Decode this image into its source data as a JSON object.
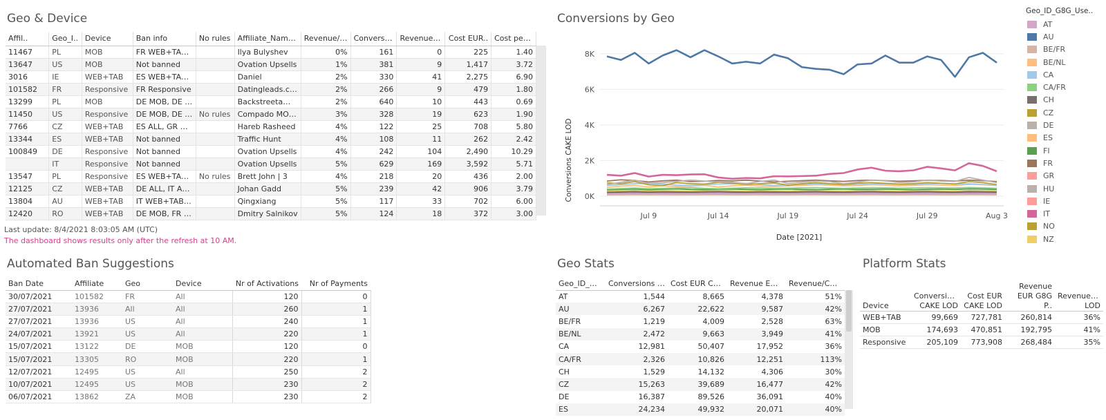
{
  "geo_device": {
    "title": "Geo & Device",
    "columns": [
      "Affil..",
      "Geo_I..",
      "Device",
      "Ban info",
      "No rules",
      "Affiliate_Name_..",
      "Revenue/C..",
      "Conversio..",
      "Revenue E..",
      "Cost EUR..",
      "Cost per C.."
    ],
    "rows": [
      [
        "11467",
        "PL",
        "MOB",
        "FR WEB+TAB, C..",
        "",
        "Ilya Bulyshev",
        "0%",
        "161",
        "0",
        "225",
        "1.40"
      ],
      [
        "13647",
        "US",
        "MOB",
        "Not banned",
        "",
        "Ovation Upsells",
        "1%",
        "381",
        "9",
        "1,417",
        "3.72"
      ],
      [
        "3016",
        "IE",
        "WEB+TAB",
        "ES WEB+TAB, ..",
        "",
        "Daniel",
        "2%",
        "330",
        "41",
        "2,275",
        "6.90"
      ],
      [
        "101582",
        "FR",
        "Responsive",
        "FR Responsive",
        "",
        "Datingleads.com..",
        "2%",
        "266",
        "9",
        "479",
        "1.80"
      ],
      [
        "13299",
        "PL",
        "MOB",
        "DE MOB, DE W..",
        "",
        "Backstreetaffili..",
        "2%",
        "640",
        "10",
        "443",
        "0.69"
      ],
      [
        "11450",
        "US",
        "Responsive",
        "DE MOB, DE W..",
        "No rules",
        "Compado MOB C..",
        "3%",
        "328",
        "19",
        "623",
        "1.90"
      ],
      [
        "7766",
        "CZ",
        "WEB+TAB",
        "ES ALL, GR WE..",
        "",
        "Hareb Rasheed",
        "4%",
        "122",
        "25",
        "708",
        "5.80"
      ],
      [
        "13344",
        "ES",
        "WEB+TAB",
        "Not banned",
        "",
        "Traffic Hunt",
        "4%",
        "108",
        "11",
        "262",
        "2.42"
      ],
      [
        "100849",
        "DE",
        "Responsive",
        "Not banned",
        "",
        "Ovation Upsells",
        "4%",
        "242",
        "104",
        "2,490",
        "10.29"
      ],
      [
        "",
        "IT",
        "Responsive",
        "Not banned",
        "",
        "Ovation Upsells",
        "5%",
        "629",
        "169",
        "3,592",
        "5.71"
      ],
      [
        "13547",
        "PL",
        "Responsive",
        "ES WEB+TAB, P..",
        "No rules",
        "Brett John | 3",
        "4%",
        "218",
        "20",
        "436",
        "2.00"
      ],
      [
        "12125",
        "CZ",
        "WEB+TAB",
        "DE ALL, IT ALL, ..",
        "",
        "Johan Gadd",
        "5%",
        "239",
        "42",
        "906",
        "3.79"
      ],
      [
        "13804",
        "AU",
        "WEB+TAB",
        "IT WEB+TAB, U..",
        "",
        "Qingxiang",
        "5%",
        "117",
        "33",
        "702",
        "6.00"
      ],
      [
        "12420",
        "RO",
        "WEB+TAB",
        "DE MOB, FR W..",
        "",
        "Dmitry Salnikov",
        "5%",
        "124",
        "18",
        "372",
        "3.00"
      ]
    ],
    "last_update": "Last update: 8/4/2021 8:03:05 AM (UTC)",
    "refresh_note": "The dashboard shows results only after the refresh at 10 AM."
  },
  "conversions_by_geo": {
    "title": "Conversions by Geo",
    "chart_data": {
      "type": "line",
      "title": "Conversions by Geo",
      "xlabel": "Date [2021]",
      "ylabel": "Conversions CAKE LOD",
      "x_ticks": [
        "Jul 9",
        "Jul 14",
        "Jul 19",
        "Jul 24",
        "Jul 29",
        "Aug 3"
      ],
      "y_ticks": [
        "0K",
        "2K",
        "4K",
        "6K",
        "8K"
      ],
      "ylim": [
        0,
        9000
      ],
      "x": [
        "Jul 6",
        "Jul 7",
        "Jul 8",
        "Jul 9",
        "Jul 10",
        "Jul 11",
        "Jul 12",
        "Jul 13",
        "Jul 14",
        "Jul 15",
        "Jul 16",
        "Jul 17",
        "Jul 18",
        "Jul 19",
        "Jul 20",
        "Jul 21",
        "Jul 22",
        "Jul 23",
        "Jul 24",
        "Jul 25",
        "Jul 26",
        "Jul 27",
        "Jul 28",
        "Jul 29",
        "Jul 30",
        "Jul 31",
        "Aug 1",
        "Aug 2",
        "Aug 3"
      ],
      "series": [
        {
          "name": "US",
          "color": "#4e79a7",
          "values": [
            7850,
            7650,
            8050,
            7450,
            7900,
            8200,
            7800,
            8200,
            7850,
            7450,
            7550,
            7450,
            7950,
            7750,
            7250,
            7150,
            7100,
            6850,
            7400,
            7450,
            7900,
            7500,
            7500,
            7850,
            7650,
            6700,
            7800,
            8050,
            7500
          ]
        },
        {
          "name": "IT",
          "color": "#d4669a",
          "values": [
            1200,
            1150,
            1300,
            1100,
            1200,
            1180,
            1220,
            1230,
            1050,
            980,
            1020,
            1000,
            1120,
            1110,
            1130,
            1150,
            1250,
            1300,
            1500,
            1600,
            1430,
            1400,
            1450,
            1650,
            1560,
            1450,
            1850,
            1700,
            1400
          ]
        },
        {
          "name": "DE",
          "color": "#bab0ac",
          "values": [
            650,
            780,
            900,
            720,
            760,
            830,
            900,
            850,
            800,
            780,
            700,
            830,
            900,
            720,
            790,
            850,
            820,
            700,
            790,
            900,
            860,
            770,
            800,
            900,
            850,
            830,
            1050,
            900,
            760
          ]
        },
        {
          "name": "CZ",
          "color": "#b8a032",
          "values": [
            750,
            700,
            820,
            640,
            600,
            760,
            700,
            680,
            780,
            720,
            660,
            700,
            740,
            620,
            700,
            760,
            700,
            660,
            730,
            760,
            720,
            680,
            700,
            760,
            720,
            690,
            820,
            760,
            650
          ]
        },
        {
          "name": "CA",
          "color": "#a0cbe8",
          "values": [
            600,
            650,
            700,
            720,
            690,
            620,
            600,
            640,
            680,
            700,
            720,
            650,
            600,
            630,
            660,
            700,
            680,
            640,
            650,
            680,
            700,
            660,
            640,
            690,
            720,
            680,
            700,
            660,
            600
          ]
        },
        {
          "name": "FR",
          "color": "#9c755f",
          "values": [
            850,
            920,
            880,
            800,
            860,
            900,
            820,
            840,
            880,
            860,
            900,
            850,
            800,
            840,
            870,
            900,
            860,
            830,
            880,
            900,
            870,
            840,
            860,
            890,
            880,
            850,
            900,
            870,
            820
          ]
        },
        {
          "name": "ES",
          "color": "#ffbe7d",
          "values": [
            500,
            560,
            600,
            520,
            580,
            540,
            560,
            600,
            520,
            580,
            620,
            560,
            540,
            580,
            600,
            640,
            620,
            580,
            600,
            640,
            620,
            580,
            600,
            640,
            620,
            600,
            660,
            640,
            600
          ]
        },
        {
          "name": "CA/FR",
          "color": "#8cd17d",
          "values": [
            400,
            430,
            460,
            420,
            440,
            460,
            480,
            440,
            420,
            450,
            470,
            460,
            440,
            450,
            470,
            480,
            460,
            440,
            460,
            480,
            470,
            450,
            460,
            480,
            470,
            460,
            490,
            470,
            440
          ]
        },
        {
          "name": "AU",
          "color": "#59a14f",
          "values": [
            350,
            380,
            400,
            360,
            390,
            410,
            380,
            370,
            390,
            400,
            380,
            370,
            390,
            400,
            380,
            370,
            390,
            400,
            380,
            390,
            400,
            380,
            370,
            390,
            400,
            380,
            410,
            400,
            380
          ]
        },
        {
          "name": "CH",
          "color": "#79706e",
          "values": [
            220,
            240,
            260,
            230,
            250,
            240,
            230,
            250,
            260,
            240,
            230,
            250,
            240,
            230,
            250,
            260,
            240,
            230,
            250,
            260,
            240,
            230,
            250,
            260,
            240,
            230,
            260,
            250,
            240
          ]
        },
        {
          "name": "BE/NL",
          "color": "#f1ce63",
          "values": [
            280,
            300,
            320,
            290,
            310,
            300,
            290,
            310,
            320,
            300,
            290,
            310,
            300,
            290,
            310,
            320,
            300,
            290,
            310,
            320,
            300,
            290,
            310,
            320,
            300,
            290,
            320,
            310,
            300
          ]
        },
        {
          "name": "HU",
          "color": "#b07aa1",
          "values": [
            180,
            190,
            200,
            185,
            195,
            190,
            185,
            195,
            200,
            190,
            185,
            195,
            190,
            185,
            195,
            200,
            190,
            185,
            195,
            200,
            190,
            185,
            195,
            200,
            190,
            185,
            200,
            195,
            190
          ]
        },
        {
          "name": "AT",
          "color": "#d4a6c8",
          "values": [
            100,
            110,
            120,
            105,
            115,
            110,
            105,
            115,
            120,
            110,
            105,
            115,
            110,
            105,
            115,
            120,
            110,
            105,
            115,
            120,
            110,
            105,
            115,
            120,
            110,
            105,
            120,
            115,
            110
          ]
        },
        {
          "name": "BE/FR",
          "color": "#d7b5a6",
          "values": [
            70,
            75,
            80,
            72,
            78,
            75,
            72,
            78,
            80,
            75,
            72,
            78,
            75,
            72,
            78,
            80,
            75,
            72,
            78,
            80,
            75,
            72,
            78,
            80,
            75,
            72,
            80,
            78,
            75
          ]
        }
      ]
    },
    "legend": {
      "title": "Geo_ID_G8G_Use..",
      "items": [
        {
          "label": "AT",
          "color": "#d4a6c8"
        },
        {
          "label": "AU",
          "color": "#4e79a7"
        },
        {
          "label": "BE/FR",
          "color": "#d7b5a6"
        },
        {
          "label": "BE/NL",
          "color": "#ffbe7d"
        },
        {
          "label": "CA",
          "color": "#a0cbe8"
        },
        {
          "label": "CA/FR",
          "color": "#8cd17d"
        },
        {
          "label": "CH",
          "color": "#79706e"
        },
        {
          "label": "CZ",
          "color": "#b8a032"
        },
        {
          "label": "DE",
          "color": "#bab0ac"
        },
        {
          "label": "ES",
          "color": "#ffbe7d"
        },
        {
          "label": "FI",
          "color": "#59a14f"
        },
        {
          "label": "FR",
          "color": "#9c755f"
        },
        {
          "label": "GR",
          "color": "#ff9d9a"
        },
        {
          "label": "HU",
          "color": "#bab0ac"
        },
        {
          "label": "IE",
          "color": "#ff9d9a"
        },
        {
          "label": "IT",
          "color": "#d4669a"
        },
        {
          "label": "NO",
          "color": "#b8a032"
        },
        {
          "label": "NZ",
          "color": "#f1ce63"
        }
      ]
    }
  },
  "ban_suggestions": {
    "title": "Automated Ban Suggestions",
    "columns": [
      "Ban Date",
      "Affiliate",
      "Geo",
      "Device",
      "Nr of Activations",
      "Nr of Payments"
    ],
    "rows": [
      [
        "30/07/2021",
        "101582",
        "FR",
        "All",
        "120",
        "0"
      ],
      [
        "27/07/2021",
        "13936",
        "All",
        "All",
        "260",
        "1"
      ],
      [
        "27/07/2021",
        "13936",
        "US",
        "All",
        "240",
        "1"
      ],
      [
        "24/07/2021",
        "13921",
        "US",
        "All",
        "220",
        "1"
      ],
      [
        "15/07/2021",
        "13122",
        "DE",
        "MOB",
        "120",
        "0"
      ],
      [
        "15/07/2021",
        "13305",
        "RO",
        "MOB",
        "220",
        "1"
      ],
      [
        "12/07/2021",
        "12495",
        "US",
        "All",
        "250",
        "2"
      ],
      [
        "10/07/2021",
        "12495",
        "US",
        "MOB",
        "230",
        "2"
      ],
      [
        "06/07/2021",
        "13862",
        "ZA",
        "MOB",
        "230",
        "2"
      ]
    ]
  },
  "geo_stats": {
    "title": "Geo Stats",
    "columns": [
      "Geo_ID_G8..",
      "Conversions C..",
      "Cost EUR CAK..",
      "Revenue EUR ..",
      "Revenue/Cost.."
    ],
    "rows": [
      [
        "AT",
        "1,544",
        "8,665",
        "4,378",
        "51%"
      ],
      [
        "AU",
        "6,267",
        "22,622",
        "9,587",
        "42%"
      ],
      [
        "BE/FR",
        "1,219",
        "4,009",
        "2,528",
        "63%"
      ],
      [
        "BE/NL",
        "2,472",
        "9,663",
        "3,949",
        "41%"
      ],
      [
        "CA",
        "12,981",
        "50,407",
        "17,952",
        "36%"
      ],
      [
        "CA/FR",
        "2,326",
        "10,826",
        "12,251",
        "113%"
      ],
      [
        "CH",
        "1,529",
        "14,132",
        "4,306",
        "30%"
      ],
      [
        "CZ",
        "15,263",
        "39,689",
        "16,477",
        "42%"
      ],
      [
        "DE",
        "16,387",
        "89,526",
        "36,091",
        "40%"
      ],
      [
        "ES",
        "24,234",
        "49,932",
        "20,071",
        "40%"
      ]
    ]
  },
  "platform_stats": {
    "title": "Platform Stats",
    "columns": [
      "Device",
      "Conversions CAKE LOD",
      "Cost EUR CAKE LOD",
      "Revenue EUR G8G P..",
      "Revenue/Cost LOD"
    ],
    "rows": [
      [
        "WEB+TAB",
        "99,669",
        "727,781",
        "260,814",
        "36%"
      ],
      [
        "MOB",
        "174,693",
        "470,851",
        "192,795",
        "41%"
      ],
      [
        "Responsive",
        "205,109",
        "773,908",
        "268,484",
        "35%"
      ]
    ]
  }
}
